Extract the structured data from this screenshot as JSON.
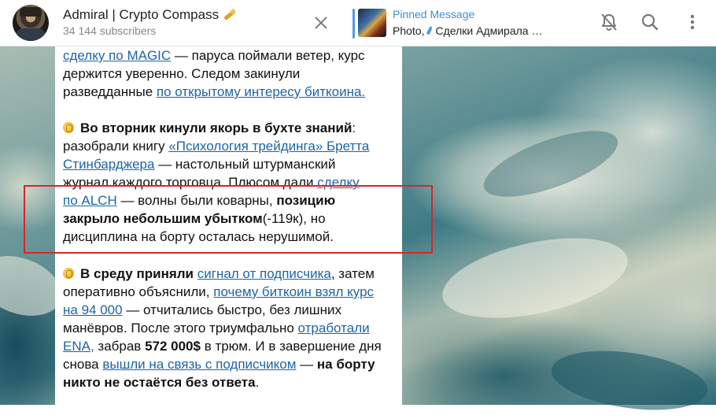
{
  "header": {
    "channel_title": "Admiral | Crypto Compass",
    "channel_emoji_icon": "pencil-icon",
    "subscribers": "34 144 subscribers",
    "pinned": {
      "label": "Pinned Message",
      "preview_prefix": "Photo,",
      "preview_icon": "feather-icon",
      "preview_text": "Сделки Адмирала …"
    },
    "actions": [
      "bell-off-icon",
      "search-icon",
      "more-icon"
    ]
  },
  "message": {
    "p1": {
      "l1_link": "сделку по MAGIC",
      "l1_text": " — паруса поймали ветер, курс",
      "l2": "держится уверенно. Следом закинули",
      "l3_text": "разведданные ",
      "l3_link": "по открытому интересу биткоина."
    },
    "p2": {
      "icon": "coin-icon",
      "l1_bold": "Во вторник кинули якорь в бухте знаний",
      "l1_colon": ":",
      "l2_text": "разобрали книгу ",
      "l2_link": "«Психология трейдинга» Бретта",
      "l3_link": "Стинбарджера",
      "l3_text": " — настольный штурманский",
      "l4_text": "журнал каждого торговца. Плюсом дали ",
      "l4_link": "сделку",
      "l5_link": "по ALCH",
      "l5_text": " — волны были коварны, ",
      "l5_bold": "позицию",
      "l6_bold": "закрыло небольшим убытком",
      "l6_text": "(-119к), но",
      "l7": "дисциплина на борту осталась нерушимой."
    },
    "p3": {
      "icon": "coin-icon",
      "l1_bold": "В среду приняли",
      "l1_sp": " ",
      "l1_link": "сигнал от подписчика",
      "l1_text": ", затем",
      "l2_text": "оперативно объяснили, ",
      "l2_link": "почему биткоин взял курс",
      "l3_link": "на 94 000",
      "l3_text": " — отчитались быстро, без лишних",
      "l4_text": "манёвров. После этого триумфально ",
      "l4_link": "отработали",
      "l5_link": "ENA,",
      "l5_text": " забрав ",
      "l5_bold": "572 000$",
      "l5_text2": " в трюм. И в завершение дня",
      "l6_text": "снова ",
      "l6_link": "вышли на связь с подписчиком",
      "l6_text2": " — ",
      "l6_bold": "на борту",
      "l7_bold": "никто не остаётся без ответа",
      "l7_text": "."
    }
  },
  "colors": {
    "link": "#1d64a7",
    "pinned_accent": "#3d8fd6",
    "highlight_box": "#d6262a"
  }
}
